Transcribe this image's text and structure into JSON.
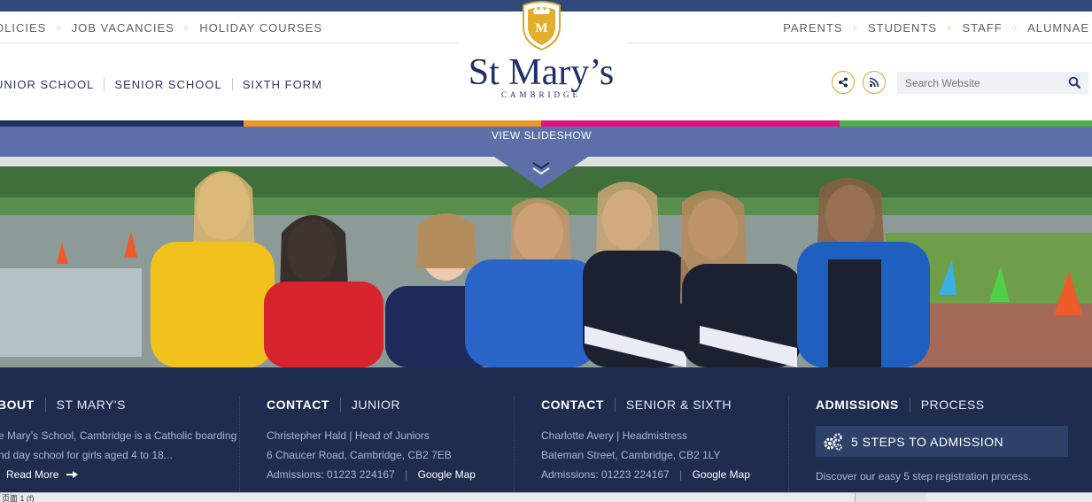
{
  "top_nav_left": [
    "OLICIES",
    "JOB VACANCIES",
    "HOLIDAY COURSES"
  ],
  "top_nav_right": [
    "PARENTS",
    "STUDENTS",
    "STAFF",
    "ALUMNAE"
  ],
  "school_nav": [
    "UNIOR SCHOOL",
    "SENIOR SCHOOL",
    "SIXTH FORM"
  ],
  "logo": {
    "name": "St Mary’s",
    "sub": "CAMBRIDGE"
  },
  "search": {
    "placeholder": "Search Website"
  },
  "icons": {
    "share": "share-icon",
    "rss": "rss-icon",
    "search": "search-icon",
    "crest": "crest-icon",
    "gears": "gears-icon"
  },
  "colors": {
    "navy": "#1e2c4e",
    "gold": "#d9a62c",
    "stripe_navy": "#1d2f5f",
    "stripe_orange": "#ef9424",
    "stripe_pink": "#e0147f",
    "stripe_green": "#4caf3f",
    "slideshow_band": "#5c6fa8"
  },
  "slideshow": {
    "label": "VIEW SLIDESHOW"
  },
  "footer": {
    "about": {
      "head": "BOUT",
      "rest": "ST MARY'S",
      "line1": "e Mary’s School, Cambridge is a Catholic boarding",
      "line2": "nd day school for girls aged 4 to 18...",
      "read_more": "Read More"
    },
    "junior": {
      "head": "CONTACT",
      "rest": "JUNIOR",
      "line1": "Christepher Hald  |  Head of Juniors",
      "line2": "6 Chaucer Road, Cambridge, CB2 7EB",
      "admissions": "Admissions: 01223 224167",
      "map": "Google Map"
    },
    "senior": {
      "head": "CONTACT",
      "rest": "SENIOR & SIXTH",
      "line1": "Charlotte Avery  |  Headmistress",
      "line2": "Bateman Street, Cambridge, CB2 1LY",
      "admissions": "Admissions: 01223 224167",
      "map": "Google Map"
    },
    "admissions": {
      "head": "ADMISSIONS",
      "rest": "PROCESS",
      "box": "5 STEPS TO ADMISSION",
      "line1": "Discover our easy 5 step registration process."
    }
  },
  "taskbar": {
    "status": "页面 1 (f)"
  }
}
